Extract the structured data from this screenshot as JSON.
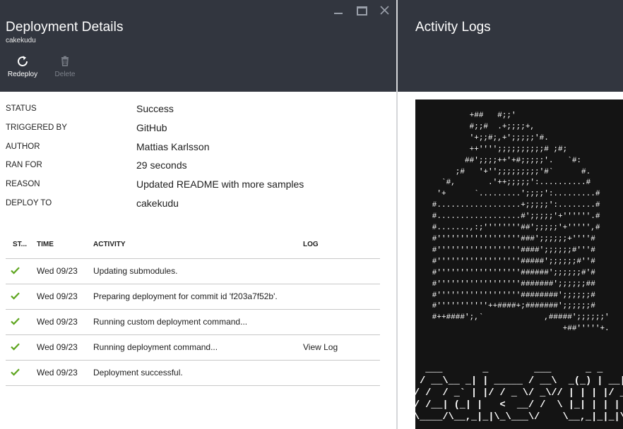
{
  "left_blade": {
    "title": "Deployment Details",
    "subtitle": "cakekudu",
    "commands": [
      {
        "label": "Redeploy",
        "icon": "refresh-icon",
        "enabled": true
      },
      {
        "label": "Delete",
        "icon": "trash-icon",
        "enabled": false
      }
    ],
    "properties": [
      {
        "key": "STATUS",
        "value": "Success"
      },
      {
        "key": "TRIGGERED BY",
        "value": "GitHub"
      },
      {
        "key": "AUTHOR",
        "value": "Mattias Karlsson"
      },
      {
        "key": "RAN FOR",
        "value": "29 seconds"
      },
      {
        "key": "REASON",
        "value": "Updated README with more samples"
      },
      {
        "key": "DEPLOY TO",
        "value": "cakekudu"
      }
    ],
    "grid": {
      "headers": {
        "status": "ST...",
        "time": "TIME",
        "activity": "ACTIVITY",
        "log": "LOG"
      },
      "rows": [
        {
          "status_icon": "check-icon",
          "time": "Wed 09/23",
          "activity": "Updating submodules.",
          "log": ""
        },
        {
          "status_icon": "check-icon",
          "time": "Wed 09/23",
          "activity": "Preparing deployment for commit id 'f203a7f52b'.",
          "log": ""
        },
        {
          "status_icon": "check-icon",
          "time": "Wed 09/23",
          "activity": "Running custom deployment command...",
          "log": ""
        },
        {
          "status_icon": "check-icon",
          "time": "Wed 09/23",
          "activity": "Running deployment command...",
          "log": "View Log"
        },
        {
          "status_icon": "check-icon",
          "time": "Wed 09/23",
          "activity": "Deployment successful.",
          "log": ""
        }
      ]
    }
  },
  "right_blade": {
    "title": "Activity Logs",
    "ascii_art": "           +##   #;;'\n           #;;#  .+;;;;+,\n           '+;;#;,+';;;;;'#.\n           ++'''';;;;;;;;;;# ;#;\n          ##';;;;++'+#;;;;;'.   `#:\n        ;#   '+'';;;;;;;;;'#`      #.\n     `#,       .'++;;;;;':..........#\n    '+      `.........';;;;':.........#\n   #..................+;;;;;':........#\n   #..................#';;;;;'+''''''.#\n   #.......,:;''''''''##';;;;;'+''''',#\n   #''''''''''''''''''###';;;;;;+''''#\n   #''''''''''''''''''####';;;;;;#'''#\n   #''''''''''''''''''#####';;;;;;#''#\n   #''''''''''''''''''######';;;;;;#'#\n   #''''''''''''''''''#######';;;;;;##\n   #''''''''''''''''''########';;;;;;#\n   #'''''''''''++####+;#######';;;;;;#\n   #++####';,`             ,#####';;;;;;'\n                               +##'''''+.",
    "banner": "  ___       _        ___      _ _    _\n / __\\__ _| | _____ / __\\  _(_) | __| |\n/ /  / _` | |/ / _ \\/ _\\// | | | |/ _` |\n/ /__| (_| |   <  __/ /  \\ |_| | | | (_| |\n\\____/\\__,_|_|\\_\\___\\/    \\__,_|_|_|\\__,_|"
  }
}
